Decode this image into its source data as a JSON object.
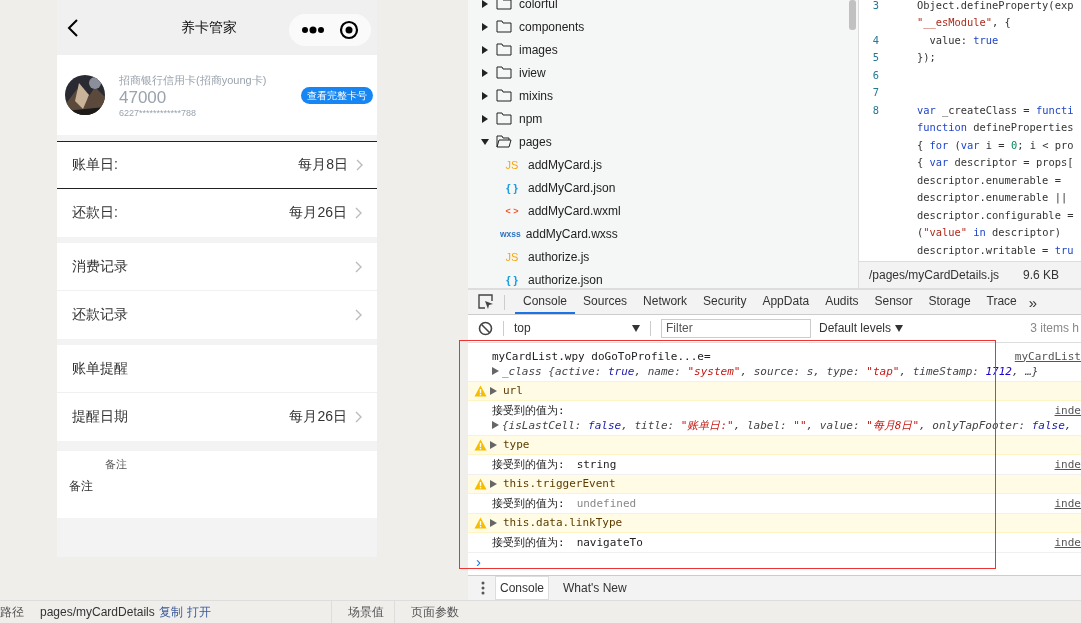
{
  "phone": {
    "nav_title": "养卡管家",
    "card": {
      "bank": "招商银行信用卡(招商young卡)",
      "limit": "47000",
      "number": "6227************788",
      "button": "查看完整卡号"
    },
    "groups": [
      [
        {
          "label": "账单日:",
          "value": "每月8日",
          "arrow": true,
          "highlighted": true
        },
        {
          "label": "还款日:",
          "value": "每月26日",
          "arrow": true,
          "highlighted": false
        }
      ],
      [
        {
          "label": "消费记录",
          "arrow": true,
          "highlighted": false
        },
        {
          "label": "还款记录",
          "arrow": true,
          "highlighted": false
        }
      ],
      [
        {
          "label": "账单提醒",
          "arrow": false,
          "highlighted": false
        },
        {
          "label": "提醒日期",
          "value": "每月26日",
          "arrow": true,
          "highlighted": false
        }
      ]
    ],
    "remark": {
      "label": "备注",
      "value": "备注"
    }
  },
  "file_tree": [
    {
      "name": "colorful",
      "kind": "folder",
      "expanded": false
    },
    {
      "name": "components",
      "kind": "folder",
      "expanded": false
    },
    {
      "name": "images",
      "kind": "folder",
      "expanded": false
    },
    {
      "name": "iview",
      "kind": "folder",
      "expanded": false
    },
    {
      "name": "mixins",
      "kind": "folder",
      "expanded": false
    },
    {
      "name": "npm",
      "kind": "folder",
      "expanded": false
    },
    {
      "name": "pages",
      "kind": "folder",
      "expanded": true,
      "children": [
        {
          "name": "addMyCard.js",
          "kind": "js",
          "icon": "JS"
        },
        {
          "name": "addMyCard.json",
          "kind": "json",
          "icon": "{ }"
        },
        {
          "name": "addMyCard.wxml",
          "kind": "wxml",
          "icon": "< >"
        },
        {
          "name": "addMyCard.wxss",
          "kind": "wxss",
          "icon": "wxss"
        },
        {
          "name": "authorize.js",
          "kind": "js",
          "icon": "JS"
        },
        {
          "name": "authorize.json",
          "kind": "json",
          "icon": "{ }"
        }
      ]
    }
  ],
  "editor": {
    "lines": [
      {
        "num": "3",
        "segments": [
          {
            "text": "Object.defineProperty(exp",
            "kind": "plain"
          }
        ]
      },
      {
        "segments": [
          {
            "text": "\"__esModule\"",
            "kind": "str"
          },
          {
            "text": ", {",
            "kind": "plain"
          }
        ]
      },
      {
        "num": "4",
        "segments": [
          {
            "text": "  value: ",
            "kind": "plain"
          },
          {
            "text": "true",
            "kind": "kw"
          }
        ]
      },
      {
        "num": "5",
        "segments": [
          {
            "text": "});",
            "kind": "plain"
          }
        ]
      },
      {
        "num": "6"
      },
      {
        "num": "7"
      },
      {
        "num": "8",
        "segments": [
          {
            "text": "var",
            "kind": "kw"
          },
          {
            "text": " _createClass = ",
            "kind": "plain"
          },
          {
            "text": "functi",
            "kind": "kw"
          }
        ]
      },
      {
        "segments": [
          {
            "text": "function",
            "kind": "kw"
          },
          {
            "text": " defineProperties",
            "kind": "plain"
          }
        ]
      },
      {
        "segments": [
          {
            "text": "{ ",
            "kind": "plain"
          },
          {
            "text": "for",
            "kind": "kw"
          },
          {
            "text": " (",
            "kind": "plain"
          },
          {
            "text": "var",
            "kind": "kw"
          },
          {
            "text": " i = ",
            "kind": "plain"
          },
          {
            "text": "0",
            "kind": "num"
          },
          {
            "text": "; i < pro",
            "kind": "plain"
          }
        ]
      },
      {
        "segments": [
          {
            "text": "{ ",
            "kind": "plain"
          },
          {
            "text": "var",
            "kind": "kw"
          },
          {
            "text": " descriptor = props[",
            "kind": "plain"
          }
        ]
      },
      {
        "segments": [
          {
            "text": "descriptor.enumerable =",
            "kind": "plain"
          }
        ]
      },
      {
        "segments": [
          {
            "text": "descriptor.enumerable ||",
            "kind": "plain"
          }
        ]
      },
      {
        "segments": [
          {
            "text": "descriptor.configurable =",
            "kind": "plain"
          }
        ]
      },
      {
        "segments": [
          {
            "text": "(",
            "kind": "plain"
          },
          {
            "text": "\"value\"",
            "kind": "str"
          },
          {
            "text": " in",
            "kind": "kw"
          },
          {
            "text": " descriptor)",
            "kind": "plain"
          }
        ]
      },
      {
        "segments": [
          {
            "text": "descriptor.writable = ",
            "kind": "plain"
          },
          {
            "text": "tru",
            "kind": "kw"
          }
        ]
      }
    ],
    "file_path": "/pages/myCardDetails.js",
    "file_size": "9.6 KB"
  },
  "devtools": {
    "tabs": [
      {
        "label": "Console",
        "selected": true
      },
      {
        "label": "Sources",
        "selected": false
      },
      {
        "label": "Network",
        "selected": false
      },
      {
        "label": "Security",
        "selected": false
      },
      {
        "label": "AppData",
        "selected": false
      },
      {
        "label": "Audits",
        "selected": false
      },
      {
        "label": "Sensor",
        "selected": false
      },
      {
        "label": "Storage",
        "selected": false
      },
      {
        "label": "Trace",
        "selected": false
      }
    ],
    "more": "»",
    "context": "top",
    "filter_placeholder": "Filter",
    "levels": "Default levels",
    "hidden_count": "3 items h",
    "messages": [
      {
        "kind": "log",
        "text": "myCardList.wpy doGoToProfile...e=",
        "source": "myCardList",
        "object": [
          {
            "text": "_class {active: ",
            "kind": "plain"
          },
          {
            "text": "true",
            "kind": "bool"
          },
          {
            "text": ", name: ",
            "kind": "plain"
          },
          {
            "text": "\"system\"",
            "kind": "str"
          },
          {
            "text": ", source: s, type: ",
            "kind": "plain"
          },
          {
            "text": "\"tap\"",
            "kind": "str"
          },
          {
            "text": ", timeStamp: ",
            "kind": "plain"
          },
          {
            "text": "1712",
            "kind": "num"
          },
          {
            "text": ", …}",
            "kind": "plain"
          }
        ]
      },
      {
        "kind": "warn",
        "text": "url"
      },
      {
        "kind": "log",
        "text": "接受到的值为:",
        "source": "inde",
        "object": [
          {
            "text": "{isLastCell: ",
            "kind": "plain"
          },
          {
            "text": "false",
            "kind": "bool"
          },
          {
            "text": ", title: ",
            "kind": "plain"
          },
          {
            "text": "\"账单日:\"",
            "kind": "str"
          },
          {
            "text": ", label: ",
            "kind": "plain"
          },
          {
            "text": "\"\"",
            "kind": "str"
          },
          {
            "text": ", value: ",
            "kind": "plain"
          },
          {
            "text": "\"每月8日\"",
            "kind": "str"
          },
          {
            "text": ", onlyTapFooter: ",
            "kind": "plain"
          },
          {
            "text": "false",
            "kind": "bool"
          },
          {
            "text": ",",
            "kind": "plain"
          }
        ]
      },
      {
        "kind": "warn",
        "text": "type"
      },
      {
        "kind": "log",
        "text": "接受到的值为:",
        "value": "string",
        "value_muted": false,
        "source": "inde"
      },
      {
        "kind": "warn",
        "text": "this.triggerEvent"
      },
      {
        "kind": "log",
        "text": "接受到的值为:",
        "value": "undefined",
        "value_muted": true,
        "source": "inde"
      },
      {
        "kind": "warn",
        "text": "this.data.linkType"
      },
      {
        "kind": "log",
        "text": "接受到的值为:",
        "value": "navigateTo",
        "value_muted": false,
        "source": "inde"
      }
    ],
    "prompt": "›",
    "drawer_tabs": [
      {
        "label": "Console",
        "selected": true
      },
      {
        "label": "What's New",
        "selected": false
      }
    ]
  },
  "status_bar": {
    "path_label": "路径",
    "path": "pages/myCardDetails",
    "copy": "复制",
    "open": "打开",
    "scene": "场景值",
    "params": "页面参数"
  }
}
